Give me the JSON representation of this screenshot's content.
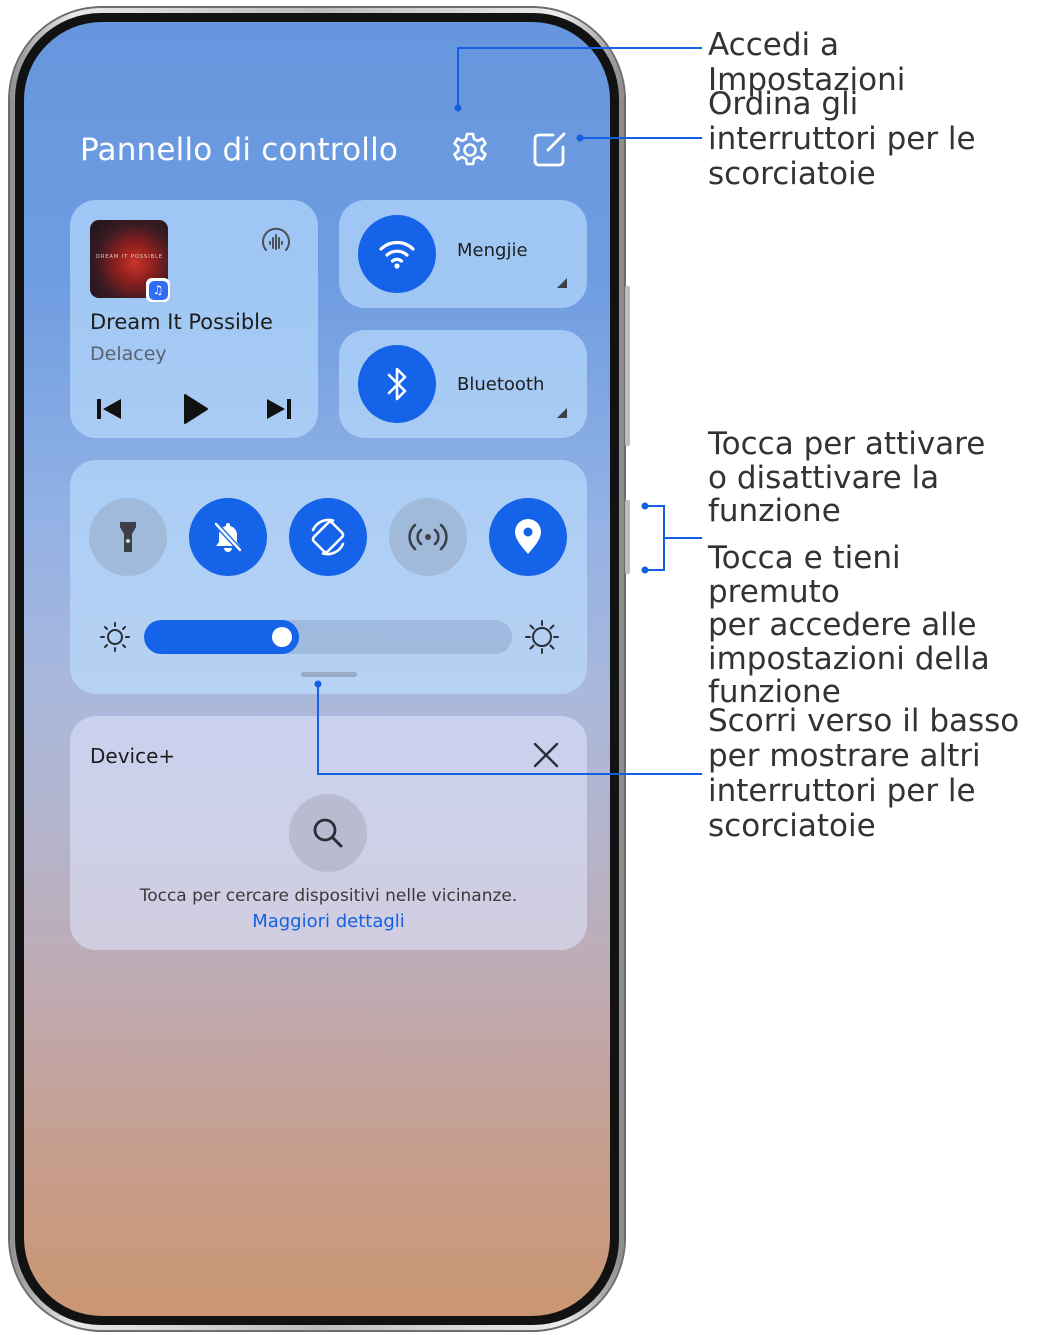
{
  "panel": {
    "title": "Pannello di controllo",
    "icons": {
      "settings": "gear-icon",
      "edit": "edit-square-icon"
    }
  },
  "media": {
    "song": "Dream It Possible",
    "artist": "Delacey",
    "album_art_text": "DREAM IT POSSIBLE",
    "controls": [
      "previous-icon",
      "play-icon",
      "next-icon"
    ],
    "cast_icon": "audio-output-icon",
    "app_badge": "music-app-icon"
  },
  "tiles": {
    "wifi": {
      "label": "Mengjie",
      "icon": "wifi-icon",
      "state": "on"
    },
    "bluetooth": {
      "label": "Bluetooth",
      "icon": "bluetooth-icon",
      "state": "on"
    }
  },
  "shortcuts": [
    {
      "name": "flashlight",
      "icon": "flashlight-icon",
      "state": "off"
    },
    {
      "name": "silent",
      "icon": "bell-off-icon",
      "state": "on"
    },
    {
      "name": "auto-rotate",
      "icon": "rotate-icon",
      "state": "on"
    },
    {
      "name": "nfc",
      "icon": "nfc-icon",
      "state": "off"
    },
    {
      "name": "location",
      "icon": "location-icon",
      "state": "on"
    }
  ],
  "brightness": {
    "level": 0.42
  },
  "device_plus": {
    "title": "Device+",
    "hint": "Tocca per cercare dispositivi nelle vicinanze.",
    "link": "Maggiori dettagli"
  },
  "annotations": {
    "settings_line1": "Accedi a Impostazioni",
    "sort_line1": "Ordina gli",
    "sort_line2": "interruttori per le",
    "sort_line3": "scorciatoie",
    "toggle_line1": "Tocca per attivare",
    "toggle_line2": "o disattivare la",
    "toggle_line3": "funzione",
    "hold_line1": "Tocca e tieni premuto",
    "hold_line2": "per accedere alle",
    "hold_line3": "impostazioni della",
    "hold_line4": "funzione",
    "swipe_line1": "Scorri verso il basso",
    "swipe_line2": "per mostrare altri",
    "swipe_line3": "interruttori per le",
    "swipe_line4": "scorciatoie"
  },
  "colors": {
    "accent": "#1463e8",
    "annotation_line": "#1560e2",
    "link": "#1560e2"
  }
}
